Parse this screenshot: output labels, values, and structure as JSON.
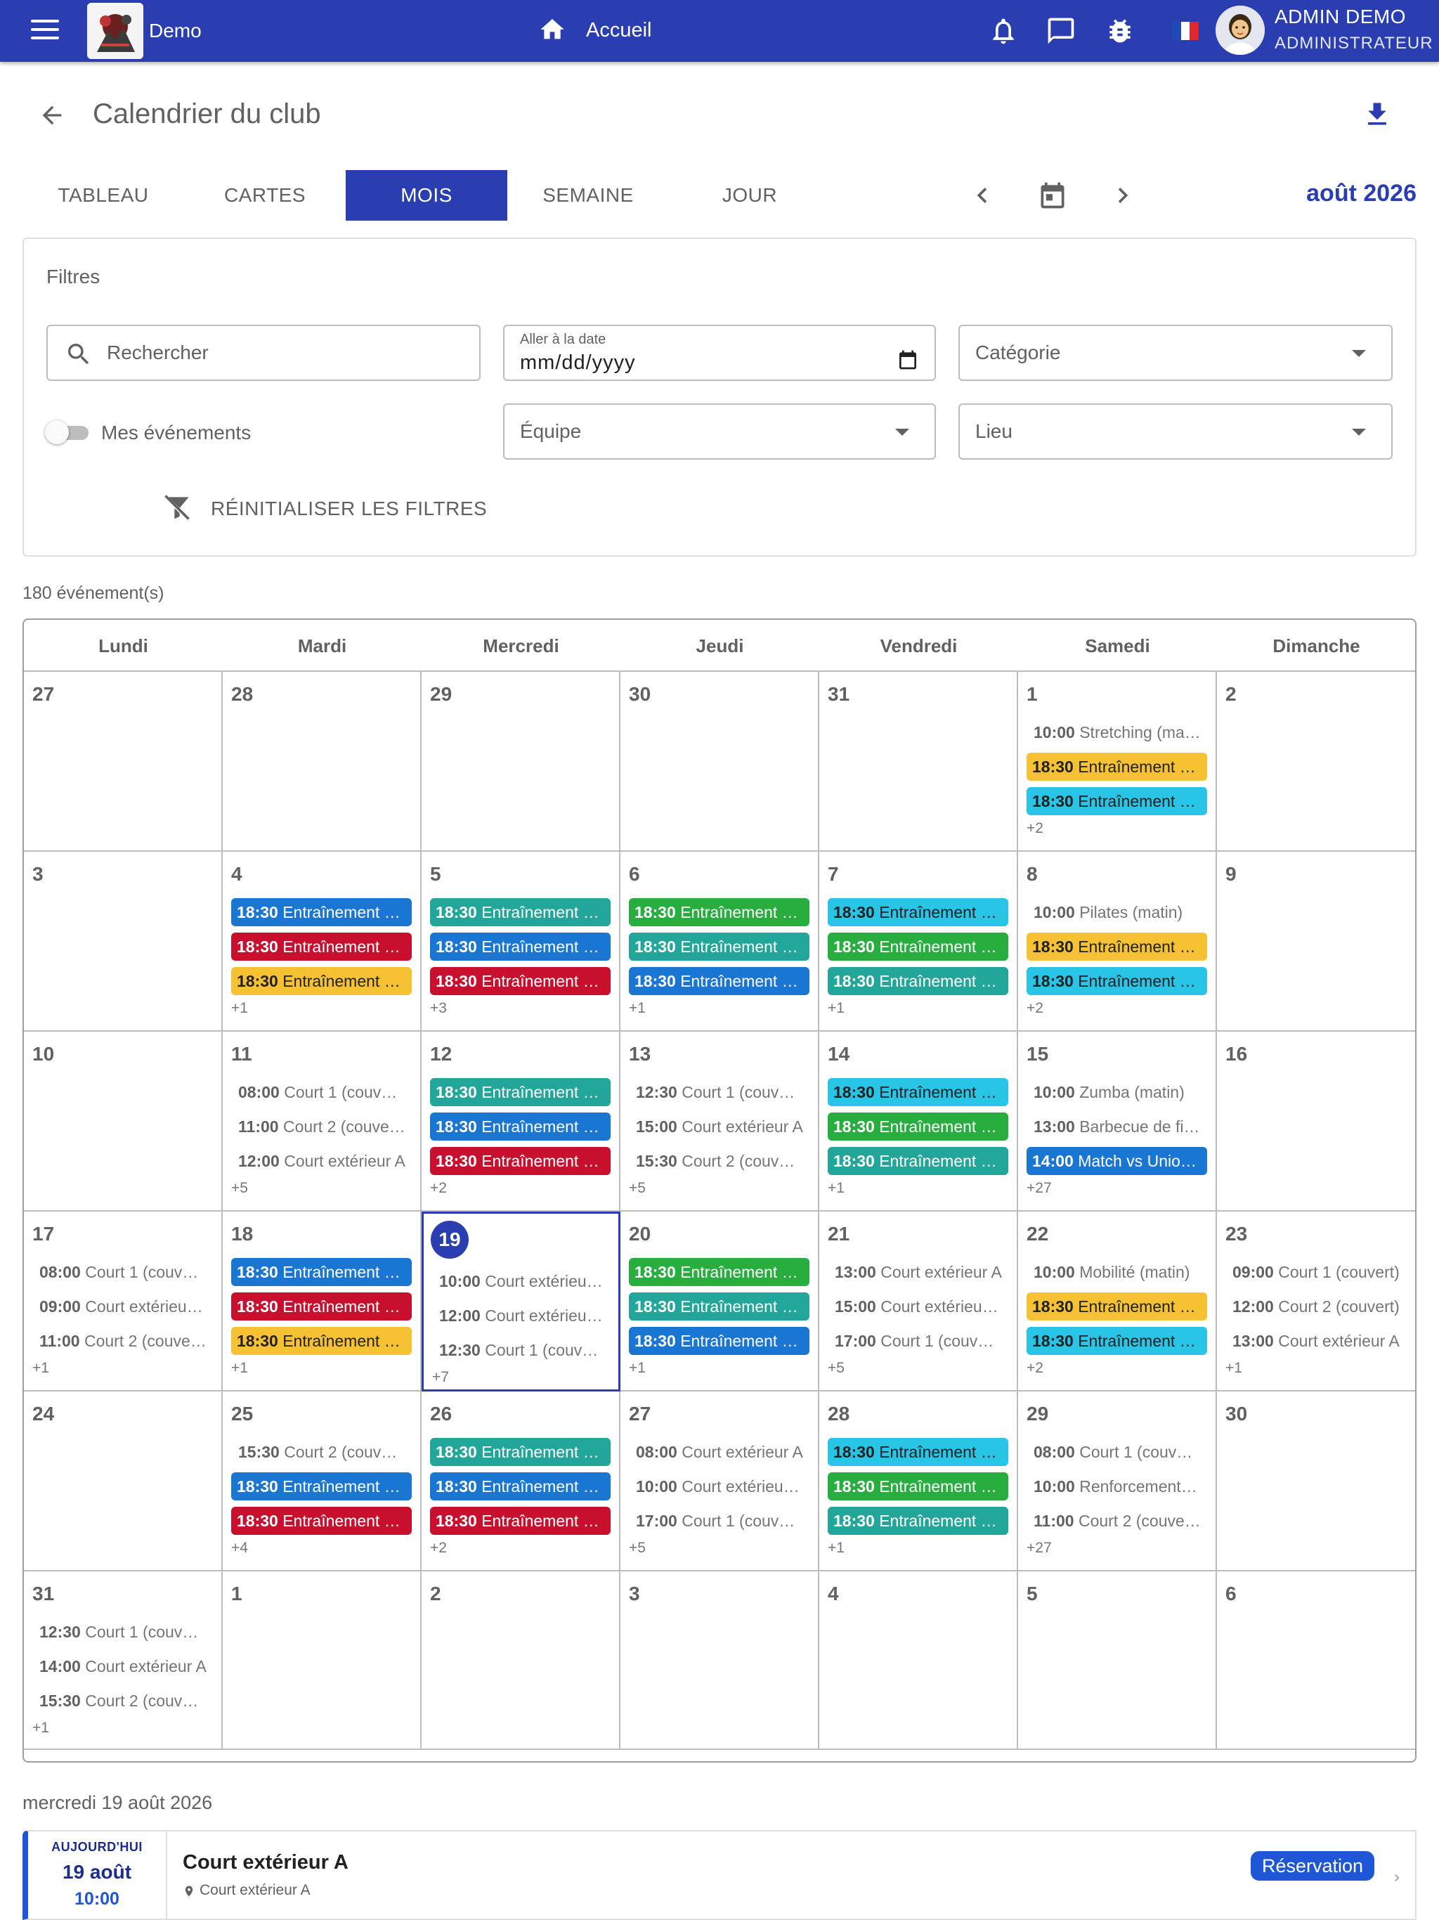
{
  "appbar": {
    "brand": "Demo",
    "home_label": "Accueil",
    "user_name": "ADMIN DEMO",
    "user_role": "ADMINISTRATEUR",
    "colors": {
      "primary": "#2a3eb1"
    },
    "icons": [
      "menu-icon",
      "home-icon",
      "bell-icon",
      "chat-icon",
      "bug-icon",
      "flag-fr-icon"
    ]
  },
  "page": {
    "title": "Calendrier du club"
  },
  "tabs": [
    "TABLEAU",
    "CARTES",
    "MOIS",
    "SEMAINE",
    "JOUR"
  ],
  "active_tab": "MOIS",
  "month_label": "août 2026",
  "filters": {
    "title": "Filtres",
    "search_placeholder": "Rechercher",
    "date_label": "Aller à la date",
    "date_value": "mm/dd/yyyy",
    "category": "Catégorie",
    "team": "Équipe",
    "location": "Lieu",
    "my_events": "Mes événements",
    "reset": "RÉINITIALISER LES FILTRES"
  },
  "event_count": "180 événement(s)",
  "weekdays": [
    "Lundi",
    "Mardi",
    "Mercredi",
    "Jeudi",
    "Vendredi",
    "Samedi",
    "Dimanche"
  ],
  "weeks": [
    [
      {
        "day": "27",
        "events": []
      },
      {
        "day": "28",
        "events": []
      },
      {
        "day": "29",
        "events": []
      },
      {
        "day": "30",
        "events": []
      },
      {
        "day": "31",
        "events": []
      },
      {
        "day": "1",
        "events": [
          {
            "time": "10:00",
            "title": "Stretching (ma…",
            "color": "plain"
          },
          {
            "time": "18:30",
            "title": "Entraînement h…",
            "color": "yellow"
          },
          {
            "time": "18:30",
            "title": "Entraînement h…",
            "color": "cyan"
          }
        ],
        "more": "+2"
      },
      {
        "day": "2",
        "events": []
      }
    ],
    [
      {
        "day": "3",
        "events": []
      },
      {
        "day": "4",
        "events": [
          {
            "time": "18:30",
            "title": "Entraînement h…",
            "color": "blue"
          },
          {
            "time": "18:30",
            "title": "Entraînement h…",
            "color": "red"
          },
          {
            "time": "18:30",
            "title": "Entraînement h…",
            "color": "yellow"
          }
        ],
        "more": "+1"
      },
      {
        "day": "5",
        "events": [
          {
            "time": "18:30",
            "title": "Entraînement h…",
            "color": "teal"
          },
          {
            "time": "18:30",
            "title": "Entraînement h…",
            "color": "blue"
          },
          {
            "time": "18:30",
            "title": "Entraînement h…",
            "color": "red"
          }
        ],
        "more": "+3"
      },
      {
        "day": "6",
        "events": [
          {
            "time": "18:30",
            "title": "Entraînement h…",
            "color": "green"
          },
          {
            "time": "18:30",
            "title": "Entraînement h…",
            "color": "teal"
          },
          {
            "time": "18:30",
            "title": "Entraînement h…",
            "color": "blue"
          }
        ],
        "more": "+1"
      },
      {
        "day": "7",
        "events": [
          {
            "time": "18:30",
            "title": "Entraînement h…",
            "color": "cyan"
          },
          {
            "time": "18:30",
            "title": "Entraînement h…",
            "color": "green"
          },
          {
            "time": "18:30",
            "title": "Entraînement h…",
            "color": "teal"
          }
        ],
        "more": "+1"
      },
      {
        "day": "8",
        "events": [
          {
            "time": "10:00",
            "title": "Pilates (matin)",
            "color": "plain"
          },
          {
            "time": "18:30",
            "title": "Entraînement h…",
            "color": "yellow"
          },
          {
            "time": "18:30",
            "title": "Entraînement h…",
            "color": "cyan"
          }
        ],
        "more": "+2"
      },
      {
        "day": "9",
        "events": []
      }
    ],
    [
      {
        "day": "10",
        "events": []
      },
      {
        "day": "11",
        "events": [
          {
            "time": "08:00",
            "title": "Court 1 (couve…",
            "color": "plain"
          },
          {
            "time": "11:00",
            "title": "Court 2 (couve…",
            "color": "plain"
          },
          {
            "time": "12:00",
            "title": "Court extérieur A",
            "color": "plain"
          }
        ],
        "more": "+5"
      },
      {
        "day": "12",
        "events": [
          {
            "time": "18:30",
            "title": "Entraînement h…",
            "color": "teal"
          },
          {
            "time": "18:30",
            "title": "Entraînement h…",
            "color": "blue"
          },
          {
            "time": "18:30",
            "title": "Entraînement h…",
            "color": "red"
          }
        ],
        "more": "+2"
      },
      {
        "day": "13",
        "events": [
          {
            "time": "12:30",
            "title": "Court 1 (couve…",
            "color": "plain"
          },
          {
            "time": "15:00",
            "title": "Court extérieur A",
            "color": "plain"
          },
          {
            "time": "15:30",
            "title": "Court 2 (couve…",
            "color": "plain"
          }
        ],
        "more": "+5"
      },
      {
        "day": "14",
        "events": [
          {
            "time": "18:30",
            "title": "Entraînement h…",
            "color": "cyan"
          },
          {
            "time": "18:30",
            "title": "Entraînement h…",
            "color": "green"
          },
          {
            "time": "18:30",
            "title": "Entraînement h…",
            "color": "teal"
          }
        ],
        "more": "+1"
      },
      {
        "day": "15",
        "events": [
          {
            "time": "10:00",
            "title": "Zumba (matin)",
            "color": "plain"
          },
          {
            "time": "13:00",
            "title": "Barbecue de fi…",
            "color": "plain"
          },
          {
            "time": "14:00",
            "title": "Match vs Unio…",
            "color": "blue"
          }
        ],
        "more": "+27"
      },
      {
        "day": "16",
        "events": []
      }
    ],
    [
      {
        "day": "17",
        "events": [
          {
            "time": "08:00",
            "title": "Court 1 (couve…",
            "color": "plain"
          },
          {
            "time": "09:00",
            "title": "Court extérieur B",
            "color": "plain"
          },
          {
            "time": "11:00",
            "title": "Court 2 (couve…",
            "color": "plain"
          }
        ],
        "more": "+1"
      },
      {
        "day": "18",
        "events": [
          {
            "time": "18:30",
            "title": "Entraînement h…",
            "color": "blue"
          },
          {
            "time": "18:30",
            "title": "Entraînement h…",
            "color": "red"
          },
          {
            "time": "18:30",
            "title": "Entraînement h…",
            "color": "yellow"
          }
        ],
        "more": "+1"
      },
      {
        "day": "19",
        "today": true,
        "events": [
          {
            "time": "10:00",
            "title": "Court extérieur A",
            "color": "plain"
          },
          {
            "time": "12:00",
            "title": "Court extérieur B",
            "color": "plain"
          },
          {
            "time": "12:30",
            "title": "Court 1 (couve…",
            "color": "plain"
          }
        ],
        "more": "+7"
      },
      {
        "day": "20",
        "events": [
          {
            "time": "18:30",
            "title": "Entraînement h…",
            "color": "green"
          },
          {
            "time": "18:30",
            "title": "Entraînement h…",
            "color": "teal"
          },
          {
            "time": "18:30",
            "title": "Entraînement h…",
            "color": "blue"
          }
        ],
        "more": "+1"
      },
      {
        "day": "21",
        "events": [
          {
            "time": "13:00",
            "title": "Court extérieur A",
            "color": "plain"
          },
          {
            "time": "15:00",
            "title": "Court extérieur B",
            "color": "plain"
          },
          {
            "time": "17:00",
            "title": "Court 1 (couve…",
            "color": "plain"
          }
        ],
        "more": "+5"
      },
      {
        "day": "22",
        "events": [
          {
            "time": "10:00",
            "title": "Mobilité (matin)",
            "color": "plain"
          },
          {
            "time": "18:30",
            "title": "Entraînement h…",
            "color": "yellow"
          },
          {
            "time": "18:30",
            "title": "Entraînement h…",
            "color": "cyan"
          }
        ],
        "more": "+2"
      },
      {
        "day": "23",
        "events": [
          {
            "time": "09:00",
            "title": "Court 1 (couvert)",
            "color": "plain"
          },
          {
            "time": "12:00",
            "title": "Court 2 (couvert)",
            "color": "plain"
          },
          {
            "time": "13:00",
            "title": "Court extérieur A",
            "color": "plain"
          }
        ],
        "more": "+1"
      }
    ],
    [
      {
        "day": "24",
        "events": []
      },
      {
        "day": "25",
        "events": [
          {
            "time": "15:30",
            "title": "Court 2 (couve…",
            "color": "plain"
          },
          {
            "time": "18:30",
            "title": "Entraînement h…",
            "color": "blue"
          },
          {
            "time": "18:30",
            "title": "Entraînement h…",
            "color": "red"
          }
        ],
        "more": "+4"
      },
      {
        "day": "26",
        "events": [
          {
            "time": "18:30",
            "title": "Entraînement h…",
            "color": "teal"
          },
          {
            "time": "18:30",
            "title": "Entraînement h…",
            "color": "blue"
          },
          {
            "time": "18:30",
            "title": "Entraînement h…",
            "color": "red"
          }
        ],
        "more": "+2"
      },
      {
        "day": "27",
        "events": [
          {
            "time": "08:00",
            "title": "Court extérieur A",
            "color": "plain"
          },
          {
            "time": "10:00",
            "title": "Court extérieur B",
            "color": "plain"
          },
          {
            "time": "17:00",
            "title": "Court 1 (couve…",
            "color": "plain"
          }
        ],
        "more": "+5"
      },
      {
        "day": "28",
        "events": [
          {
            "time": "18:30",
            "title": "Entraînement h…",
            "color": "cyan"
          },
          {
            "time": "18:30",
            "title": "Entraînement h…",
            "color": "green"
          },
          {
            "time": "18:30",
            "title": "Entraînement h…",
            "color": "teal"
          }
        ],
        "more": "+1"
      },
      {
        "day": "29",
        "events": [
          {
            "time": "08:00",
            "title": "Court 1 (couve…",
            "color": "plain"
          },
          {
            "time": "10:00",
            "title": "Renforcement …",
            "color": "plain"
          },
          {
            "time": "11:00",
            "title": "Court 2 (couve…",
            "color": "plain"
          }
        ],
        "more": "+27"
      },
      {
        "day": "30",
        "events": []
      }
    ],
    [
      {
        "day": "31",
        "events": [
          {
            "time": "12:30",
            "title": "Court 1 (couve…",
            "color": "plain"
          },
          {
            "time": "14:00",
            "title": "Court extérieur A",
            "color": "plain"
          },
          {
            "time": "15:30",
            "title": "Court 2 (couve…",
            "color": "plain"
          }
        ],
        "more": "+1"
      },
      {
        "day": "1",
        "events": []
      },
      {
        "day": "2",
        "events": []
      },
      {
        "day": "3",
        "events": []
      },
      {
        "day": "4",
        "events": []
      },
      {
        "day": "5",
        "events": []
      },
      {
        "day": "6",
        "events": []
      }
    ]
  ],
  "event_colors": {
    "blue": "#1976d2",
    "red": "#c8102e",
    "yellow": "#f6c233",
    "cyan": "#29c5e6",
    "teal": "#22a699",
    "green": "#27ae3f"
  },
  "selected_day": {
    "title": "mercredi 19 août 2026",
    "card": {
      "today_label": "AUJOURD'HUI",
      "date": "19 août",
      "time": "10:00",
      "event_title": "Court extérieur A",
      "location": "Court extérieur A",
      "badge": "Réservation"
    }
  }
}
